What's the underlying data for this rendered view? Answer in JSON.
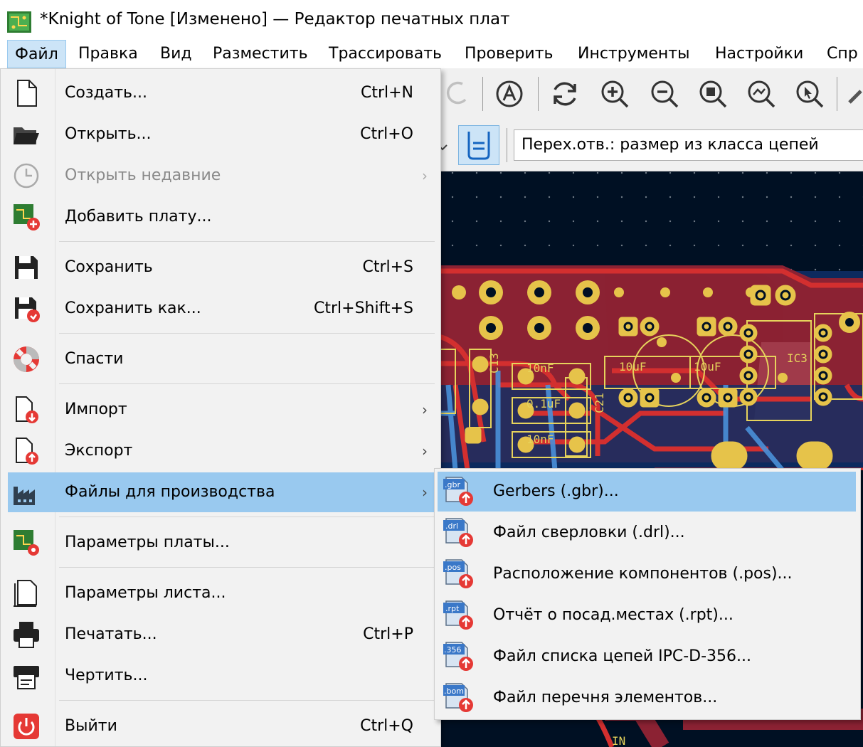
{
  "window": {
    "title": "*Knight of Tone [Изменено] — Редактор печатных плат"
  },
  "menubar": {
    "items": [
      "Файл",
      "Правка",
      "Вид",
      "Разместить",
      "Трассировать",
      "Проверить",
      "Инструменты",
      "Настройки",
      "Спр"
    ]
  },
  "toolbar": {
    "via_size": "Перех.отв.: размер из класса цепей"
  },
  "file_menu": {
    "items": [
      {
        "label": "Создать...",
        "shortcut": "Ctrl+N"
      },
      {
        "label": "Открыть...",
        "shortcut": "Ctrl+O"
      },
      {
        "label": "Открыть недавние",
        "arrow": "›"
      },
      {
        "label": "Добавить плату..."
      },
      {
        "label": "Сохранить",
        "shortcut": "Ctrl+S"
      },
      {
        "label": "Сохранить как...",
        "shortcut": "Ctrl+Shift+S"
      },
      {
        "label": "Спасти"
      },
      {
        "label": "Импорт",
        "arrow": "›"
      },
      {
        "label": "Экспорт",
        "arrow": "›"
      },
      {
        "label": "Файлы для производства",
        "arrow": "›"
      },
      {
        "label": "Параметры платы..."
      },
      {
        "label": "Параметры листа..."
      },
      {
        "label": "Печатать...",
        "shortcut": "Ctrl+P"
      },
      {
        "label": "Чертить..."
      },
      {
        "label": "Выйти",
        "shortcut": "Ctrl+Q"
      }
    ]
  },
  "fab_submenu": {
    "items": [
      {
        "label": "Gerbers (.gbr)...",
        "tag": ".gbr"
      },
      {
        "label": "Файл сверловки (.drl)...",
        "tag": ".drl"
      },
      {
        "label": "Расположение компонентов (.pos)...",
        "tag": ".pos"
      },
      {
        "label": "Отчёт о посад.местах (.rpt)...",
        "tag": ".rpt"
      },
      {
        "label": "Файл списка цепей IPC-D-356...",
        "tag": ".356"
      },
      {
        "label": "Файл перечня элементов...",
        "tag": ".bom"
      }
    ]
  },
  "pcb": {
    "silkscreen": [
      "C13",
      "10nF",
      "10uF",
      "10uF",
      "IC3",
      "C21",
      "0.1uF",
      "10nF",
      "IN"
    ]
  }
}
